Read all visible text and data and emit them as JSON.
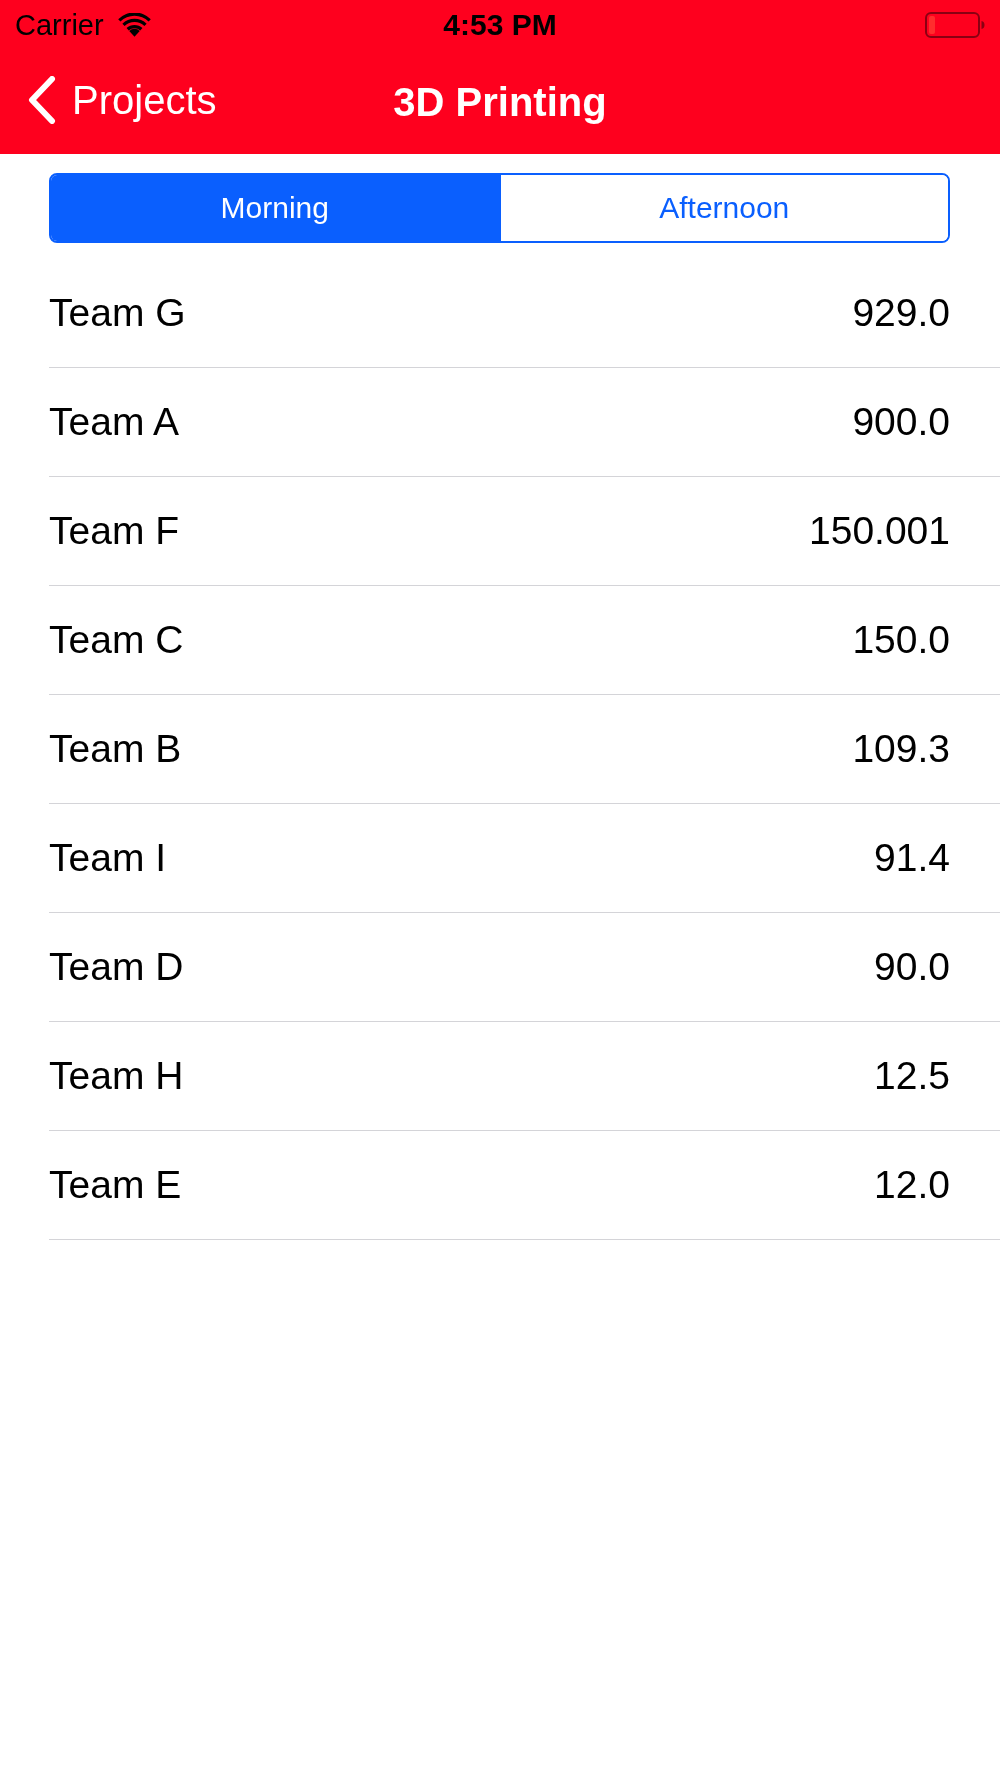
{
  "status_bar": {
    "carrier": "Carrier",
    "time": "4:53 PM"
  },
  "nav_bar": {
    "back_label": "Projects",
    "title": "3D Printing"
  },
  "segments": [
    {
      "label": "Morning",
      "selected": true
    },
    {
      "label": "Afternoon",
      "selected": false
    }
  ],
  "rows": [
    {
      "name": "Team G",
      "value": "929.0"
    },
    {
      "name": "Team A",
      "value": "900.0"
    },
    {
      "name": "Team F",
      "value": "150.001"
    },
    {
      "name": "Team C",
      "value": "150.0"
    },
    {
      "name": "Team B",
      "value": "109.3"
    },
    {
      "name": "Team I",
      "value": "91.4"
    },
    {
      "name": "Team D",
      "value": "90.0"
    },
    {
      "name": "Team H",
      "value": "12.5"
    },
    {
      "name": "Team E",
      "value": "12.0"
    }
  ]
}
